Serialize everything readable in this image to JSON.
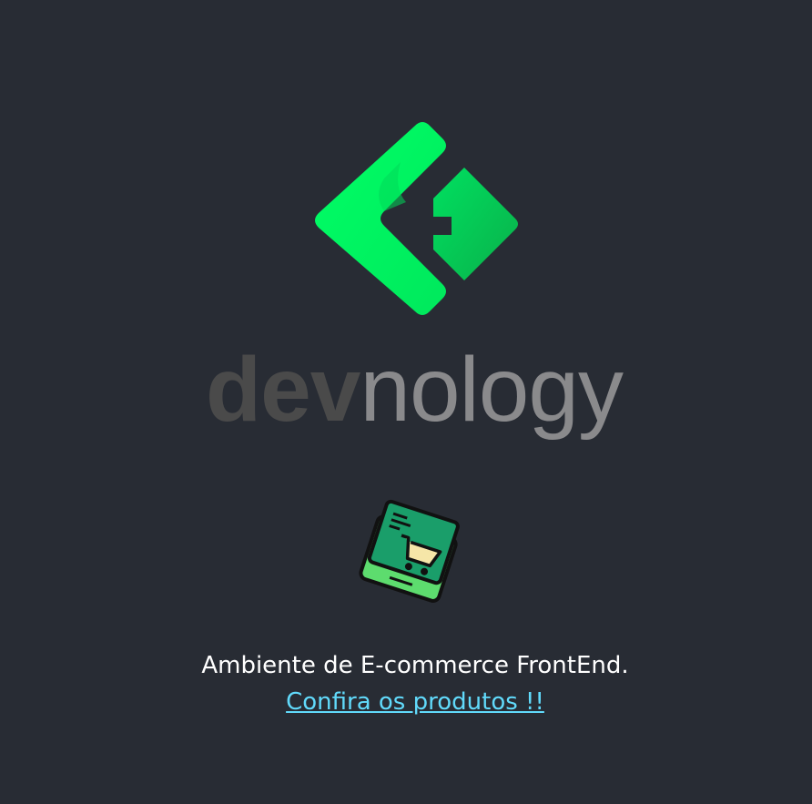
{
  "logo": {
    "wordmark_part1": "dev",
    "wordmark_part2": "nology",
    "brand_green": "#00ff66",
    "wordmark_dark": "#4a4a4a",
    "wordmark_light": "#8a8a8c"
  },
  "hero": {
    "icon": "shopping-cart-tablet-icon",
    "tagline": "Ambiente de E-commerce FrontEnd.",
    "link_text": "Confira os produtos !!",
    "link_color": "#61dafb"
  },
  "theme": {
    "background": "#282c34"
  }
}
